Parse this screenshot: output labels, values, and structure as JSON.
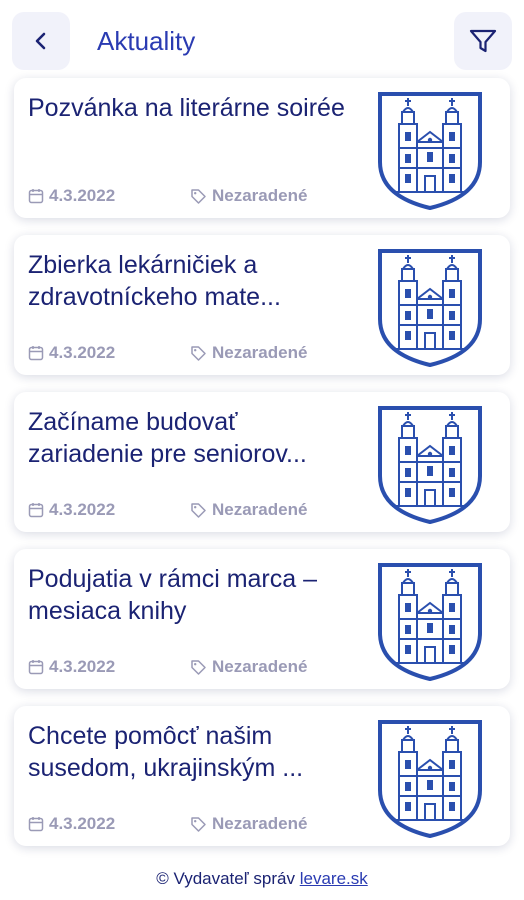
{
  "header": {
    "title": "Aktuality",
    "back_icon": "chevron-left-icon",
    "filter_icon": "filter-icon"
  },
  "articles": [
    {
      "title": "Pozvánka na literárne soirée",
      "date": "4.3.2022",
      "category": "Nezaradené"
    },
    {
      "title": "Zbierka lekárničiek a zdravotníckeho mate...",
      "date": "4.3.2022",
      "category": "Nezaradené"
    },
    {
      "title": "Začíname budovať zariadenie pre seniorov...",
      "date": "4.3.2022",
      "category": "Nezaradené"
    },
    {
      "title": "Podujatia v rámci marca – mesiaca knihy",
      "date": "4.3.2022",
      "category": "Nezaradené"
    },
    {
      "title": "Chcete pomôcť našim susedom, ukrajinským ...",
      "date": "4.3.2022",
      "category": "Nezaradené"
    }
  ],
  "footer": {
    "text": "© Vydavateľ správ ",
    "link": "levare.sk"
  },
  "colors": {
    "accent": "#2a3bb2",
    "text": "#1b2373",
    "meta": "#9a9ab6",
    "crest": "#2a4fae"
  }
}
